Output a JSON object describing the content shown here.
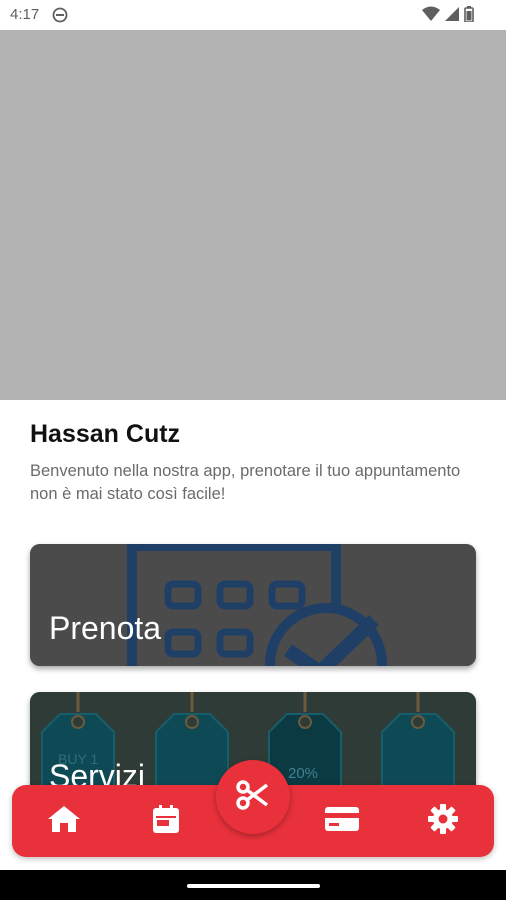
{
  "status_bar": {
    "time": "4:17",
    "icons": [
      "do-not-disturb-icon",
      "wifi-icon",
      "signal-icon",
      "battery-icon"
    ]
  },
  "home": {
    "title": "Hassan Cutz",
    "subtitle": "Benvenuto nella nostra app, prenotare il tuo appuntamento non è mai stato così facile!"
  },
  "cards": {
    "book": {
      "label": "Prenota",
      "icon": "calendar-check-icon"
    },
    "services": {
      "label": "Servizi",
      "tags": [
        "BUY 1",
        "20%"
      ]
    }
  },
  "bottom_nav": {
    "items": [
      "home-icon",
      "calendar-icon",
      "scissors-icon",
      "card-icon",
      "settings-icon"
    ],
    "accent": "#e8313b"
  },
  "colors": {
    "hero_placeholder": "#b3b3b3",
    "accent": "#e8313b"
  }
}
